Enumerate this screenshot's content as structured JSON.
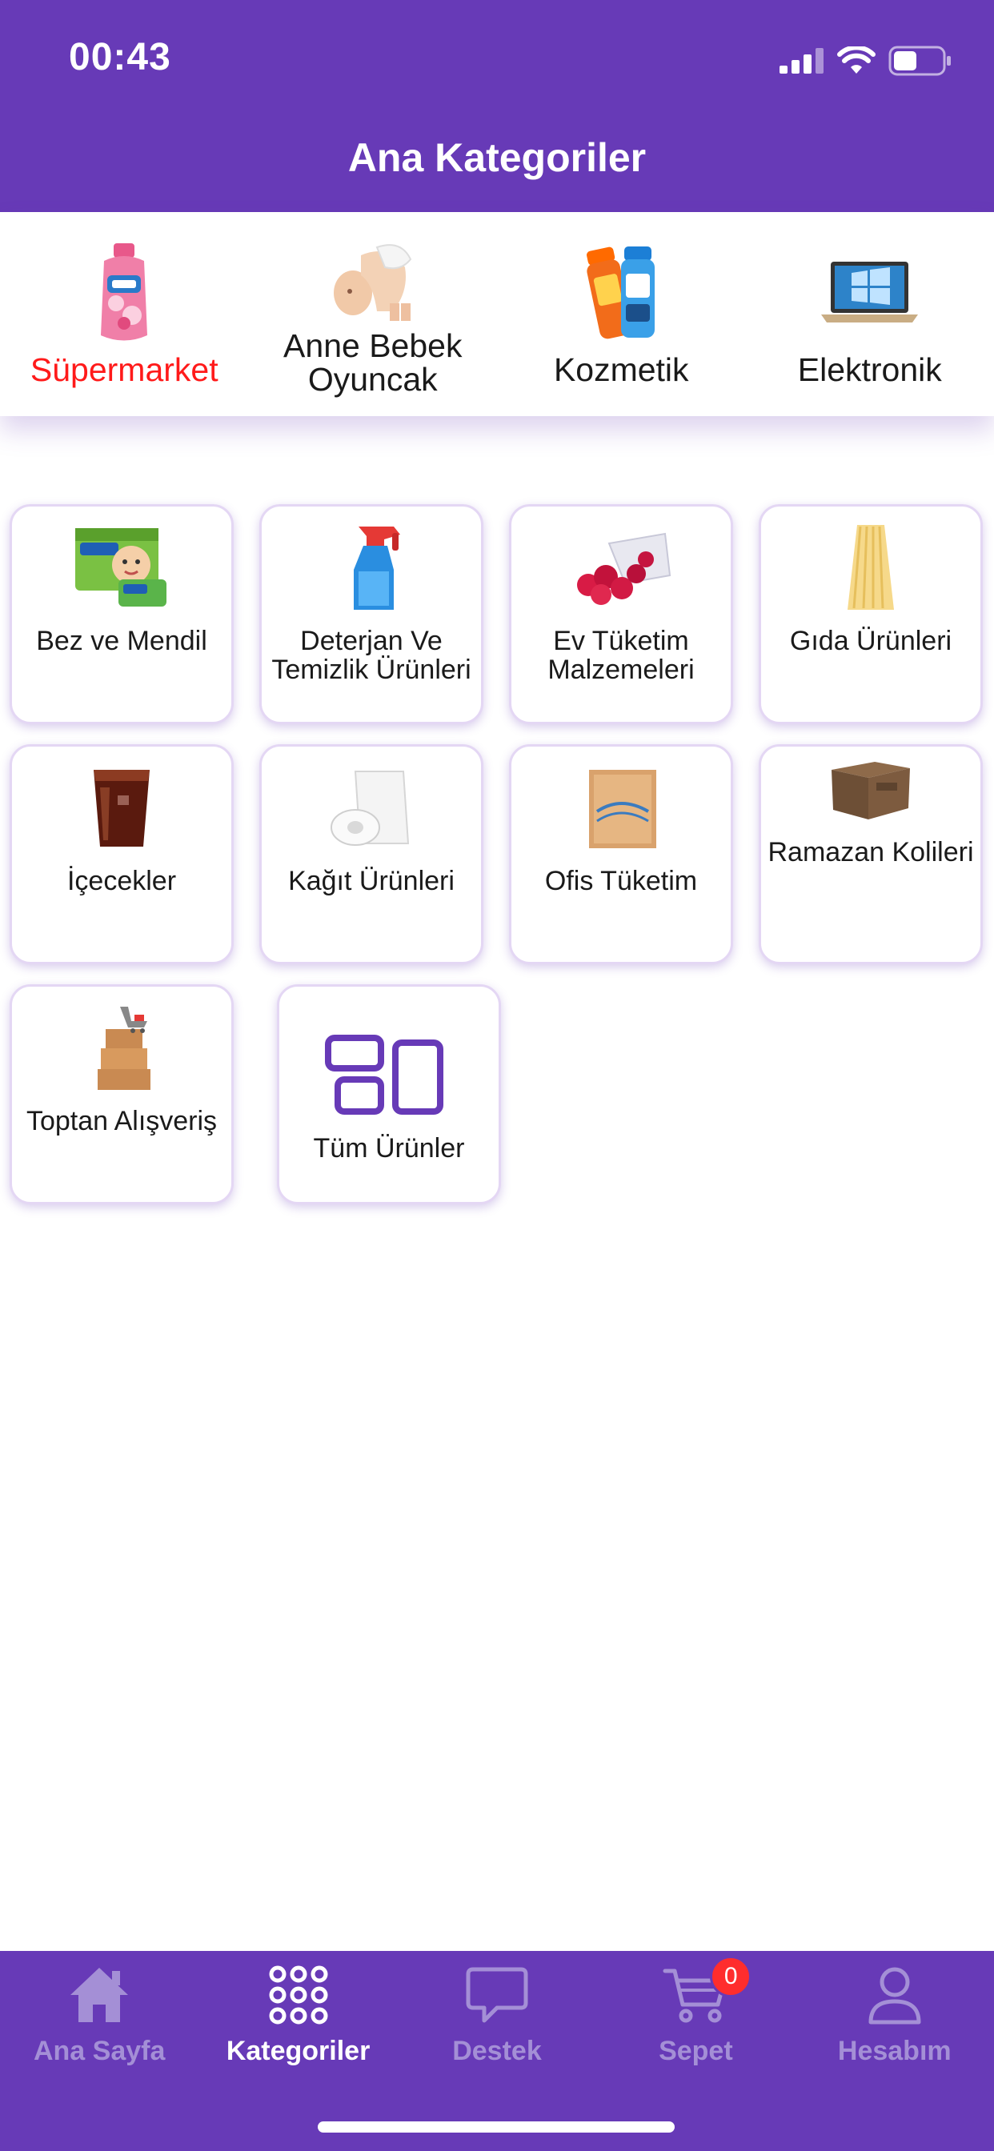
{
  "status_bar": {
    "time": "00:43"
  },
  "header": {
    "title": "Ana Kategoriler"
  },
  "main_categories": [
    {
      "label": "Süpermarket",
      "icon": "softener-bottle-image",
      "active": true
    },
    {
      "label": "Anne Bebek Oyuncak",
      "line1": "Anne Bebek",
      "line2": "Oyuncak",
      "icon": "baby-image"
    },
    {
      "label": "Kozmetik",
      "icon": "shampoo-bottles-image"
    },
    {
      "label": "Elektronik",
      "icon": "laptop-image"
    }
  ],
  "subcategories": [
    {
      "label": "Bez ve Mendil",
      "icon": "diaper-pack-image"
    },
    {
      "label": "Deterjan Ve Temizlik Ürünleri",
      "icon": "spray-bottle-image"
    },
    {
      "label": "Ev Tüketim Malzemeleri",
      "icon": "raspberries-image"
    },
    {
      "label": "Gıda Ürünleri",
      "icon": "pasta-image"
    },
    {
      "label": "İçecekler",
      "icon": "cola-glass-image"
    },
    {
      "label": "Kağıt Ürünleri",
      "icon": "paper-towel-image"
    },
    {
      "label": "Ofis Tüketim",
      "icon": "napkin-pack-image"
    },
    {
      "label": "Ramazan Kolileri",
      "icon": "cardboard-box-image"
    },
    {
      "label": "Toptan Alışveriş",
      "icon": "boxes-cart-image"
    },
    {
      "label": "Tüm Ürünler",
      "icon": "grid-layout-icon"
    }
  ],
  "tab_bar": {
    "items": [
      {
        "label": "Ana Sayfa",
        "icon": "home-icon"
      },
      {
        "label": "Kategoriler",
        "icon": "categories-dots-icon",
        "active": true
      },
      {
        "label": "Destek",
        "icon": "chat-bubble-icon"
      },
      {
        "label": "Sepet",
        "icon": "cart-icon",
        "badge": "0"
      },
      {
        "label": "Hesabım",
        "icon": "user-icon"
      }
    ]
  },
  "colors": {
    "brand": "#673ab7",
    "active_category": "#ff1a1a",
    "inactive_tab": "#a48fd6",
    "badge": "#ff2d2d"
  }
}
